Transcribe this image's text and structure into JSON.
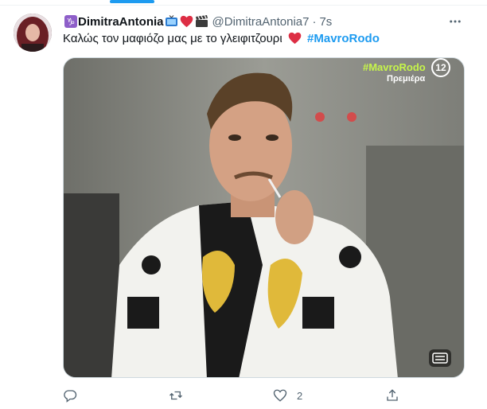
{
  "tweet": {
    "display_name": "DimitraAntonia",
    "handle": "@DimitraAntonia7",
    "separator": "·",
    "time": "7s",
    "name_emojis": [
      "capricorn-icon",
      "tv-icon",
      "red-heart-icon",
      "clapper-board-icon"
    ],
    "text": "Καλώς τον μαφιόζο μας με το γλειφιτζουρι",
    "text_emoji": "red-heart-icon",
    "hashtag": "#MavroRodo"
  },
  "media": {
    "overlay_hashtag": "#MavroRodo",
    "overlay_subtitle": "Πρεμιέρα",
    "channel_logo": "12",
    "alt_icon": "captions-icon"
  },
  "actions": {
    "reply_count": "",
    "retweet_count": "",
    "like_count": "2",
    "share_count": ""
  },
  "colors": {
    "accent": "#1d9bf0",
    "secondary_text": "#536471",
    "heart": "#e0245e",
    "overlay_green": "#c6f54a"
  }
}
